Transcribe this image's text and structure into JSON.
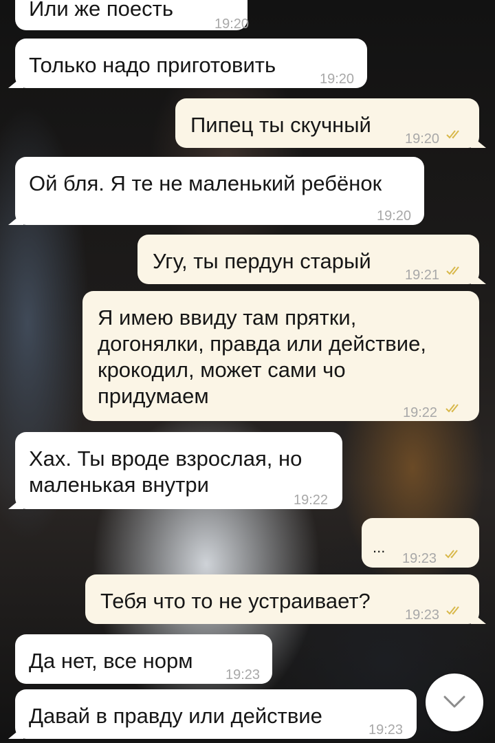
{
  "messages": [
    {
      "text": "Или же поесть",
      "time": "19:20",
      "direction": "in"
    },
    {
      "text": "Только надо приготовить",
      "time": "19:20",
      "direction": "in"
    },
    {
      "text": "Пипец ты скучный",
      "time": "19:20",
      "direction": "out",
      "status": "read"
    },
    {
      "text": "Ой бля. Я те не маленький ребёнок",
      "time": "19:20",
      "direction": "in"
    },
    {
      "text": "Угу, ты пердун старый",
      "time": "19:21",
      "direction": "out",
      "status": "read"
    },
    {
      "text": "Я имею ввиду там прятки,\nдогонялки, правда или действие,\nкрокодил, может сами чо\nпридумаем",
      "time": "19:22",
      "direction": "out",
      "status": "read"
    },
    {
      "text": "Хах. Ты вроде взрослая, но\nмаленькая внутри",
      "time": "19:22",
      "direction": "in"
    },
    {
      "text": "...",
      "time": "19:23",
      "direction": "out",
      "status": "read"
    },
    {
      "text": "Тебя что то не устраивает?",
      "time": "19:23",
      "direction": "out",
      "status": "read"
    },
    {
      "text": "Да нет, все норм",
      "time": "19:23",
      "direction": "in"
    },
    {
      "text": "Давай в правду или действие",
      "time": "19:23",
      "direction": "in"
    }
  ],
  "icons": {
    "read_receipt": "double-check-icon",
    "scroll_down": "chevron-down-icon"
  },
  "colors": {
    "incoming_bubble": "#ffffff",
    "outgoing_bubble": "#fbf5e6",
    "read_check": "#d8b84a",
    "timestamp": "#a8a8a8"
  }
}
